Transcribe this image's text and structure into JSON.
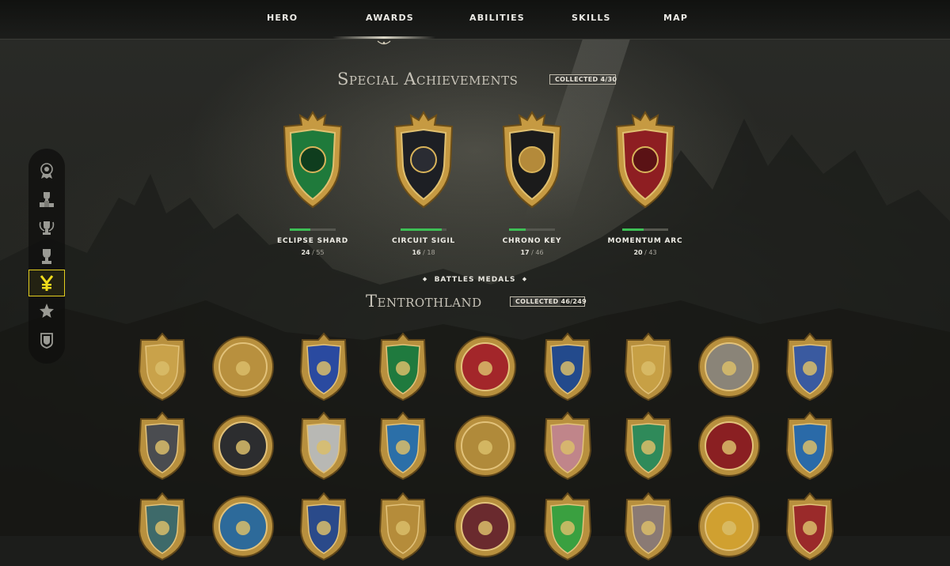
{
  "nav": {
    "items": [
      {
        "label": "HERO"
      },
      {
        "label": "AWARDS"
      },
      {
        "label": "ABILITIES"
      },
      {
        "label": "SKILLS"
      },
      {
        "label": "MAP"
      }
    ],
    "active": "AWARDS"
  },
  "special": {
    "title": "Special Achievements",
    "collected_tag": "COLLECTED",
    "collected_value": "4/30",
    "achievements": [
      {
        "name": "ECLIPSE SHARD",
        "current": "24",
        "total": "55",
        "progress": 0.44,
        "emblem": "green-orc-shield"
      },
      {
        "name": "CIRCUIT SIGIL",
        "current": "16",
        "total": "18",
        "progress": 0.89,
        "emblem": "black-eagle-crest"
      },
      {
        "name": "CHRONO KEY",
        "current": "17",
        "total": "46",
        "progress": 0.37,
        "emblem": "golden-griffin-crest"
      },
      {
        "name": "MOMENTUM ARC",
        "current": "20",
        "total": "43",
        "progress": 0.47,
        "emblem": "red-eagle-shield"
      }
    ]
  },
  "battles": {
    "subheading": "BATTLES MEDALS",
    "title": "Tentrothland",
    "collected_tag": "COLLECTED",
    "collected_value": "46/249",
    "medals": [
      {
        "icon": "golden-eagle-medal",
        "color": "#c9a24a"
      },
      {
        "icon": "griffin-crest-medal",
        "color": "#b8903e"
      },
      {
        "icon": "blue-horse-medal",
        "color": "#2a4aa0"
      },
      {
        "icon": "green-bow-medal",
        "color": "#1f7a3e"
      },
      {
        "icon": "red-eagle-shield-medal",
        "color": "#a3262a"
      },
      {
        "icon": "blue-dragon-shield-medal",
        "color": "#234a8c"
      },
      {
        "icon": "blue-eagle-crest-medal",
        "color": "#c7a045"
      },
      {
        "icon": "octopus-medal",
        "color": "#8a8478"
      },
      {
        "icon": "gnome-medal",
        "color": "#3a5aa0"
      },
      {
        "icon": "dark-beast-shield-medal",
        "color": "#4a4c50"
      },
      {
        "icon": "black-lion-shield-medal",
        "color": "#2c2d2f"
      },
      {
        "icon": "silver-eagle-medal",
        "color": "#b8b8b4"
      },
      {
        "icon": "blue-dragon-shield-medal",
        "color": "#2b6fa8"
      },
      {
        "icon": "blue-griffin-crest-medal",
        "color": "#b08a3a"
      },
      {
        "icon": "pink-rune-shield-medal",
        "color": "#c0858a"
      },
      {
        "icon": "green-lion-medal",
        "color": "#2f8a5a"
      },
      {
        "icon": "red-pentagram-medal",
        "color": "#8a1f22"
      },
      {
        "icon": "blue-star-medal",
        "color": "#2a6aa8"
      },
      {
        "icon": "dark-mirror-medal",
        "color": "#3e6a6a"
      },
      {
        "icon": "blue-crest-medal",
        "color": "#2d6a9a"
      },
      {
        "icon": "blue-gnome-medal",
        "color": "#2a4a8a"
      },
      {
        "icon": "golden-eagle-crest-medal",
        "color": "#b58c3a"
      },
      {
        "icon": "dark-red-dragon-medal",
        "color": "#6a2a2e"
      },
      {
        "icon": "green-gem-medal",
        "color": "#3aa040"
      },
      {
        "icon": "silver-eagle-shield-medal",
        "color": "#8a7a74"
      },
      {
        "icon": "phoenix-medal",
        "color": "#d0a030"
      },
      {
        "icon": "red-rose-medal",
        "color": "#9a2a2a"
      }
    ]
  },
  "sidebar": {
    "items": [
      {
        "icon": "medal-badge-icon"
      },
      {
        "icon": "podium-trophy-icon"
      },
      {
        "icon": "laurel-trophy-icon"
      },
      {
        "icon": "cup-trophy-icon"
      },
      {
        "icon": "yen-currency-icon",
        "active": true
      },
      {
        "icon": "star-shield-icon"
      },
      {
        "icon": "banner-shield-icon"
      }
    ]
  }
}
